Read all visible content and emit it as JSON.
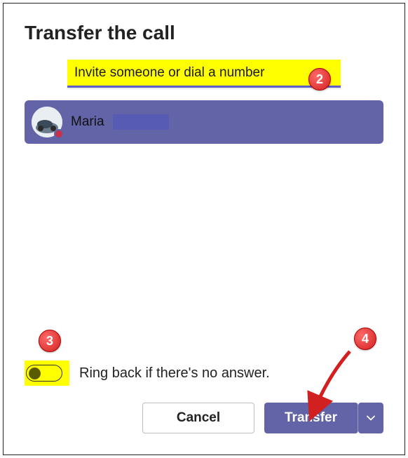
{
  "title": "Transfer the call",
  "search": {
    "placeholder": "Invite someone or dial a number",
    "value": ""
  },
  "person": {
    "name": "Maria",
    "presence": "busy"
  },
  "ringback": {
    "label": "Ring back if there's no answer.",
    "on": false
  },
  "footer": {
    "cancel": "Cancel",
    "transfer": "Transfer"
  },
  "callouts": {
    "search": "2",
    "toggle": "3",
    "transfer": "4"
  }
}
